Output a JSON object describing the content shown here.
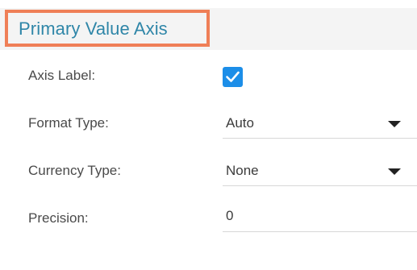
{
  "section": {
    "title": "Primary Value Axis"
  },
  "rows": {
    "axis_label": {
      "label": "Axis Label:",
      "checked": true
    },
    "format_type": {
      "label": "Format Type:",
      "value": "Auto"
    },
    "currency_type": {
      "label": "Currency Type:",
      "value": "None"
    },
    "precision": {
      "label": "Precision:",
      "value": "0"
    }
  },
  "colors": {
    "highlight_border": "#ef7f57",
    "title_text": "#2f86a8",
    "checkbox_fill": "#1c8ee8"
  },
  "icons": {
    "checkbox": "checkmark-icon",
    "dropdown": "caret-down-icon"
  }
}
